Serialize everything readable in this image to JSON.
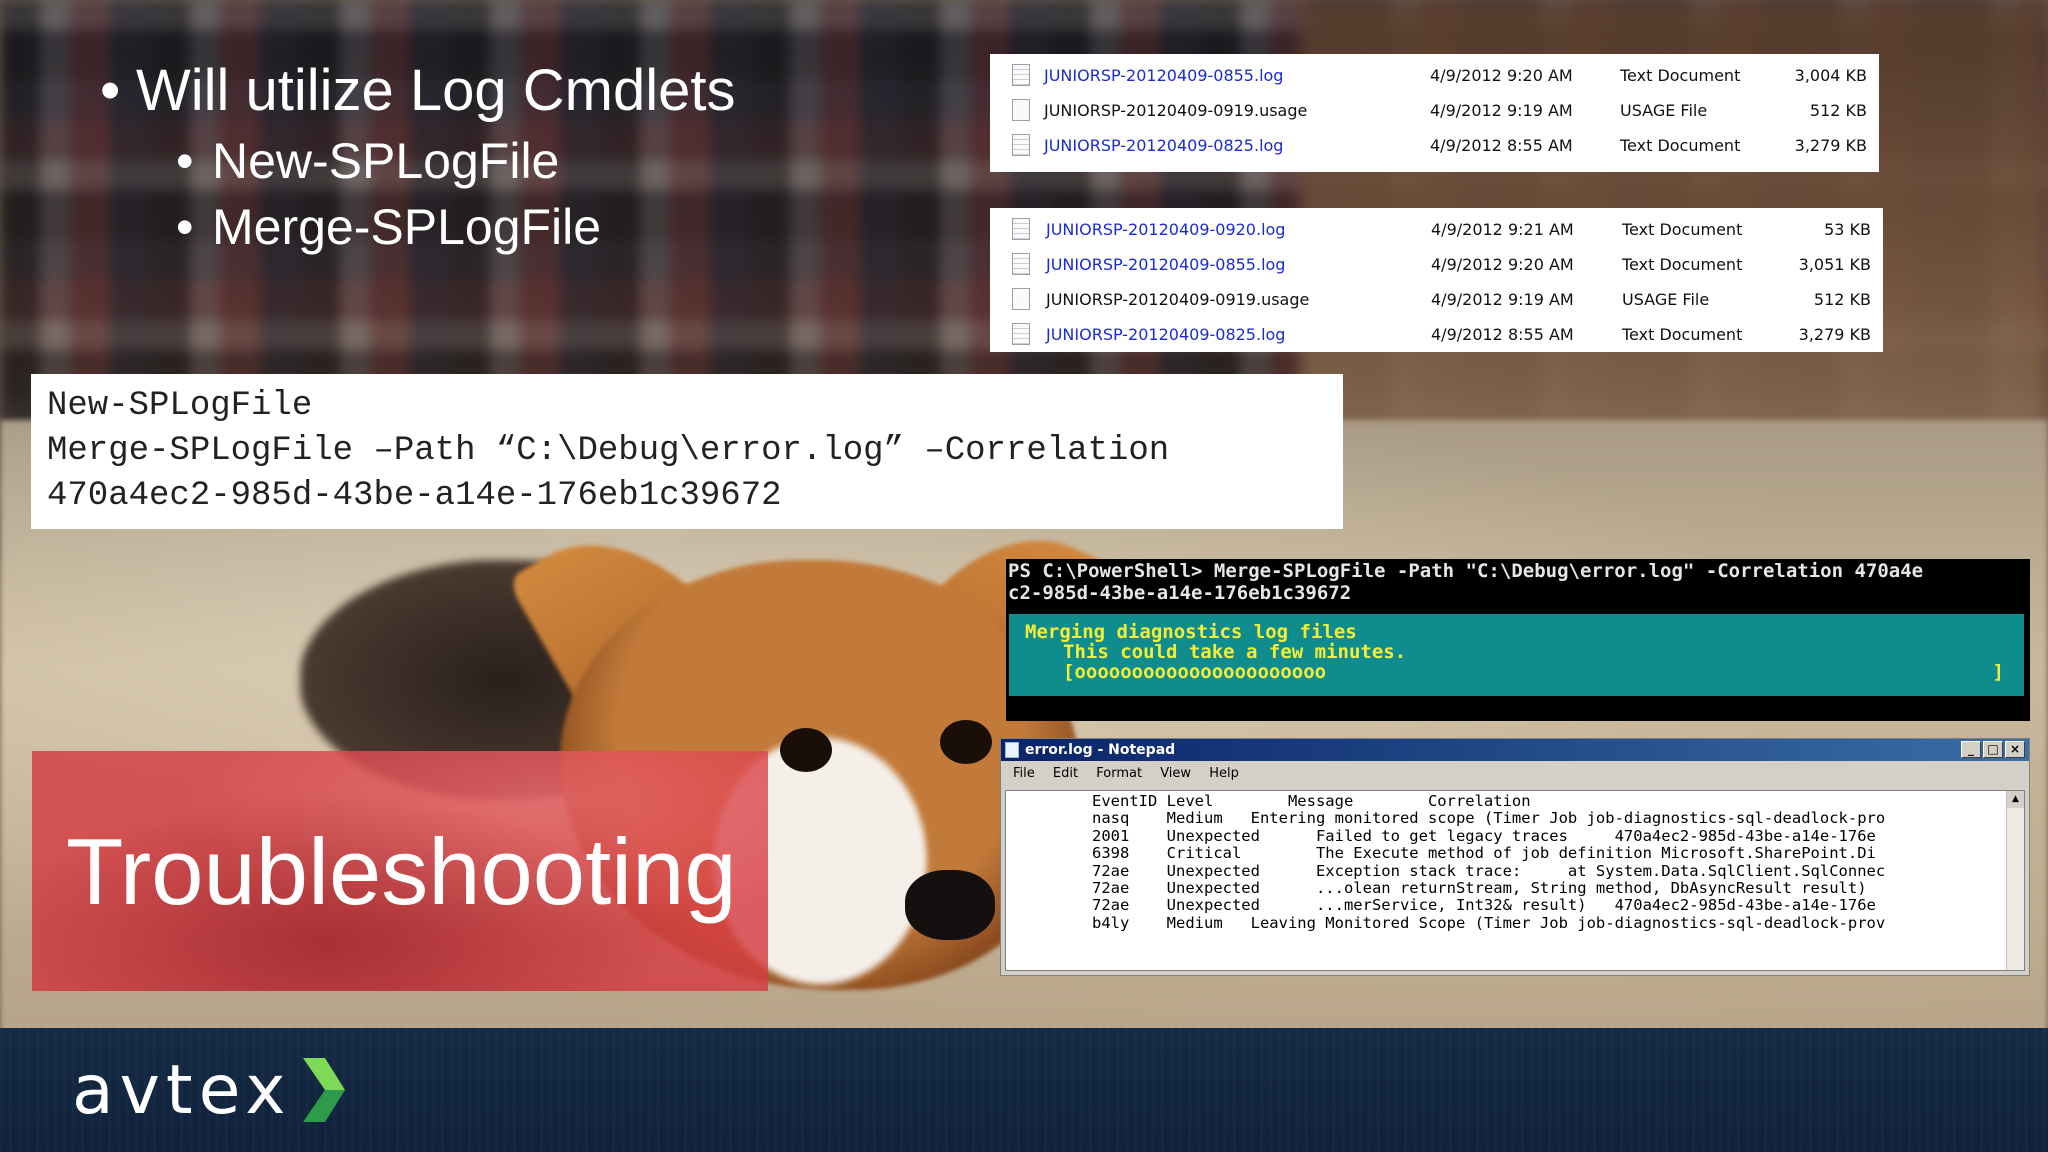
{
  "slide": {
    "bullets": {
      "main": "Will utilize Log Cmdlets",
      "subs": [
        "New-SPLogFile",
        "Merge-SPLogFile"
      ]
    },
    "banner_title": "Troubleshooting",
    "code_lines": [
      "New-SPLogFile",
      "Merge-SPLogFile –Path “C:\\Debug\\error.log” –Correlation",
      "470a4ec2-985d-43be-a14e-176eb1c39672"
    ]
  },
  "explorer_top": {
    "rows": [
      {
        "name": "JUNIORSP-20120409-0855.log",
        "date": "4/9/2012 9:20 AM",
        "type": "Text Document",
        "size": "3,004 KB",
        "link": true
      },
      {
        "name": "JUNIORSP-20120409-0919.usage",
        "date": "4/9/2012 9:19 AM",
        "type": "USAGE File",
        "size": "512 KB",
        "link": false
      },
      {
        "name": "JUNIORSP-20120409-0825.log",
        "date": "4/9/2012 8:55 AM",
        "type": "Text Document",
        "size": "3,279 KB",
        "link": true
      }
    ]
  },
  "explorer_bottom": {
    "rows": [
      {
        "name": "JUNIORSP-20120409-0920.log",
        "date": "4/9/2012 9:21 AM",
        "type": "Text Document",
        "size": "53 KB",
        "link": true
      },
      {
        "name": "JUNIORSP-20120409-0855.log",
        "date": "4/9/2012 9:20 AM",
        "type": "Text Document",
        "size": "3,051 KB",
        "link": true
      },
      {
        "name": "JUNIORSP-20120409-0919.usage",
        "date": "4/9/2012 9:19 AM",
        "type": "USAGE File",
        "size": "512 KB",
        "link": false
      },
      {
        "name": "JUNIORSP-20120409-0825.log",
        "date": "4/9/2012 8:55 AM",
        "type": "Text Document",
        "size": "3,279 KB",
        "link": true
      }
    ]
  },
  "powershell": {
    "command_line_1": "PS C:\\PowerShell> Merge-SPLogFile -Path \"C:\\Debug\\error.log\" -Correlation 470a4e",
    "command_line_2": "c2-985d-43be-a14e-176eb1c39672",
    "progress_title": "Merging diagnostics log files",
    "progress_note": "This could take a few minutes.",
    "progress_bar": "[oooooooooooooooooooooo",
    "progress_bar_end": "]",
    "colors": {
      "progress_bg": "#0e8c8e",
      "progress_text": "#f2ee3a"
    }
  },
  "notepad": {
    "title": "error.log - Notepad",
    "menu": [
      "File",
      "Edit",
      "Format",
      "View",
      "Help"
    ],
    "lines": [
      "EventID Level        Message        Correlation",
      "nasq    Medium   Entering monitored scope (Timer Job job-diagnostics-sql-deadlock-pro",
      "2001    Unexpected      Failed to get legacy traces     470a4ec2-985d-43be-a14e-176e",
      "6398    Critical        The Execute method of job definition Microsoft.SharePoint.Di",
      "72ae    Unexpected      Exception stack trace:     at System.Data.SqlClient.SqlConnec",
      "72ae    Unexpected      ...olean returnStream, String method, DbAsyncResult result)",
      "72ae    Unexpected      ...merService, Int32& result)   470a4ec2-985d-43be-a14e-176e",
      "b4ly    Medium   Leaving Monitored Scope (Timer Job job-diagnostics-sql-deadlock-prov"
    ]
  },
  "footer": {
    "logo_text": "avtex",
    "brand_colors": {
      "chevron_light": "#7ed957",
      "chevron_dark": "#2e9b4a",
      "footer_bg": "#132741"
    }
  }
}
